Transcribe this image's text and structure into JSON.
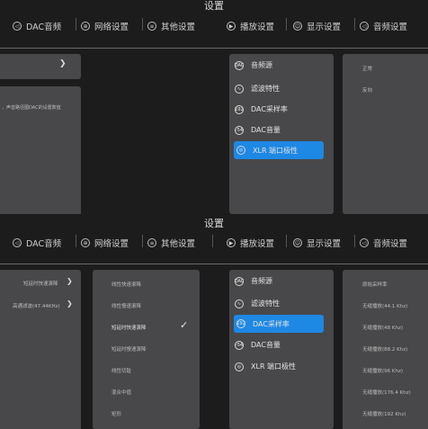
{
  "top": {
    "title": "设置",
    "tabs": [
      {
        "label": "DAC音频",
        "icon": "speaker-icon"
      },
      {
        "label": "网络设置",
        "icon": "globe-icon"
      },
      {
        "label": "其他设置",
        "icon": "list-icon"
      },
      {
        "label": "播放设置",
        "icon": "play-icon"
      },
      {
        "label": "显示设置",
        "icon": "display-icon"
      },
      {
        "label": "音频设置",
        "icon": "speaker-icon"
      }
    ],
    "left_panel_note": "，声音路径图DAC的设置数值",
    "menu": [
      {
        "label": "音频源",
        "icon": "dac-icon"
      },
      {
        "label": "滤波特性",
        "icon": "filter-icon"
      },
      {
        "label": "DAC采样率",
        "icon": "sample-rate-icon"
      },
      {
        "label": "DAC音量",
        "icon": "volume-icon"
      },
      {
        "label": "XLR 端口极性",
        "icon": "polarity-icon"
      }
    ],
    "right_options": [
      "正常",
      "反向"
    ]
  },
  "bottom": {
    "title": "设置",
    "tabs": [
      {
        "label": "DAC音频",
        "icon": "speaker-icon"
      },
      {
        "label": "网络设置",
        "icon": "globe-icon"
      },
      {
        "label": "其他设置",
        "icon": "list-icon"
      },
      {
        "label": "播放设置",
        "icon": "play-icon"
      },
      {
        "label": "显示设置",
        "icon": "display-icon"
      },
      {
        "label": "音频设置",
        "icon": "speaker-icon"
      }
    ],
    "left_items": [
      "短延时快速滚降",
      "高通滤波(47.44KHz)"
    ],
    "filter_options": [
      "线性快速滚降",
      "线性慢速滚降",
      "短延时快速滚降",
      "短延时慢速滚降",
      "线性切趾",
      "混合中值",
      "矩形"
    ],
    "menu": [
      {
        "label": "音频源",
        "icon": "dac-icon"
      },
      {
        "label": "滤波特性",
        "icon": "filter-icon"
      },
      {
        "label": "DAC采样率",
        "icon": "sample-rate-icon"
      },
      {
        "label": "DAC音量",
        "icon": "volume-icon"
      },
      {
        "label": "XLR 端口极性",
        "icon": "polarity-icon"
      }
    ],
    "sample_rates": [
      "原始采样率",
      "无缝播放(44.1 Khz)",
      "无缝播放(48 Khz)",
      "无缝播放(88.2 Khz)",
      "无缝播放(96 Khz)",
      "无缝播放(176.4 Khz)",
      "无缝播放(192 Khz)"
    ]
  },
  "colors": {
    "accent": "#1e88e5",
    "panel": "#48484a",
    "background": "#1c1c1d"
  }
}
